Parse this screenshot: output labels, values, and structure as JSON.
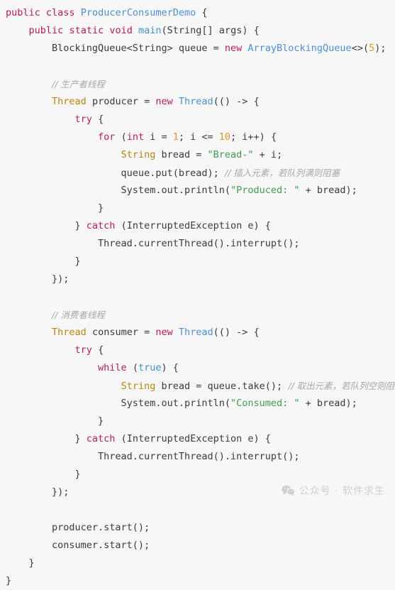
{
  "editor": {
    "language": "java",
    "background_color": "#f7f7f7",
    "default_text_color": "#3b3b3b",
    "colors": {
      "keyword": "#c2185b",
      "type": "#4a90d9",
      "declared_type": "#b8860b",
      "string": "#3f9c51",
      "number": "#d99a2b",
      "literal": "#2f95c9",
      "comment": "#a8a8a8"
    }
  },
  "code": {
    "lines": [
      [
        {
          "t": "public",
          "c": "kw"
        },
        {
          "t": " ",
          "c": "plain"
        },
        {
          "t": "class",
          "c": "kw"
        },
        {
          "t": " ",
          "c": "plain"
        },
        {
          "t": "ProducerConsumerDemo",
          "c": "type"
        },
        {
          "t": " {",
          "c": "plain"
        }
      ],
      [
        {
          "t": "    ",
          "c": "plain"
        },
        {
          "t": "public",
          "c": "kw"
        },
        {
          "t": " ",
          "c": "plain"
        },
        {
          "t": "static",
          "c": "kw"
        },
        {
          "t": " ",
          "c": "plain"
        },
        {
          "t": "void",
          "c": "kw"
        },
        {
          "t": " ",
          "c": "plain"
        },
        {
          "t": "main",
          "c": "type"
        },
        {
          "t": "(String[] args) {",
          "c": "plain"
        }
      ],
      [
        {
          "t": "        BlockingQueue<String> queue = ",
          "c": "plain"
        },
        {
          "t": "new",
          "c": "kw"
        },
        {
          "t": " ",
          "c": "plain"
        },
        {
          "t": "ArrayBlockingQueue",
          "c": "type"
        },
        {
          "t": "<>(",
          "c": "plain"
        },
        {
          "t": "5",
          "c": "num"
        },
        {
          "t": ");",
          "c": "plain"
        }
      ],
      [],
      [
        {
          "t": "        ",
          "c": "plain"
        },
        {
          "t": "// 生产者线程",
          "c": "cmt"
        }
      ],
      [
        {
          "t": "        ",
          "c": "plain"
        },
        {
          "t": "Thread",
          "c": "decl"
        },
        {
          "t": " producer = ",
          "c": "plain"
        },
        {
          "t": "new",
          "c": "kw"
        },
        {
          "t": " ",
          "c": "plain"
        },
        {
          "t": "Thread",
          "c": "type"
        },
        {
          "t": "(() -> {",
          "c": "plain"
        }
      ],
      [
        {
          "t": "            ",
          "c": "plain"
        },
        {
          "t": "try",
          "c": "kw"
        },
        {
          "t": " {",
          "c": "plain"
        }
      ],
      [
        {
          "t": "                ",
          "c": "plain"
        },
        {
          "t": "for",
          "c": "kw"
        },
        {
          "t": " (",
          "c": "plain"
        },
        {
          "t": "int",
          "c": "kw"
        },
        {
          "t": " i = ",
          "c": "plain"
        },
        {
          "t": "1",
          "c": "num"
        },
        {
          "t": "; i <= ",
          "c": "plain"
        },
        {
          "t": "10",
          "c": "num"
        },
        {
          "t": "; i++) {",
          "c": "plain"
        }
      ],
      [
        {
          "t": "                    ",
          "c": "plain"
        },
        {
          "t": "String",
          "c": "decl"
        },
        {
          "t": " bread = ",
          "c": "plain"
        },
        {
          "t": "\"Bread-\"",
          "c": "str"
        },
        {
          "t": " + i;",
          "c": "plain"
        }
      ],
      [
        {
          "t": "                    queue.put(bread); ",
          "c": "plain"
        },
        {
          "t": "// 插入元素，若队列满则阻塞",
          "c": "cmt"
        }
      ],
      [
        {
          "t": "                    System.out.println(",
          "c": "plain"
        },
        {
          "t": "\"Produced: \"",
          "c": "str"
        },
        {
          "t": " + bread);",
          "c": "plain"
        }
      ],
      [
        {
          "t": "                }",
          "c": "plain"
        }
      ],
      [
        {
          "t": "            } ",
          "c": "plain"
        },
        {
          "t": "catch",
          "c": "kw"
        },
        {
          "t": " (InterruptedException e) {",
          "c": "plain"
        }
      ],
      [
        {
          "t": "                Thread.currentThread().interrupt();",
          "c": "plain"
        }
      ],
      [
        {
          "t": "            }",
          "c": "plain"
        }
      ],
      [
        {
          "t": "        });",
          "c": "plain"
        }
      ],
      [],
      [
        {
          "t": "        ",
          "c": "plain"
        },
        {
          "t": "// 消费者线程",
          "c": "cmt"
        }
      ],
      [
        {
          "t": "        ",
          "c": "plain"
        },
        {
          "t": "Thread",
          "c": "decl"
        },
        {
          "t": " consumer = ",
          "c": "plain"
        },
        {
          "t": "new",
          "c": "kw"
        },
        {
          "t": " ",
          "c": "plain"
        },
        {
          "t": "Thread",
          "c": "type"
        },
        {
          "t": "(() -> {",
          "c": "plain"
        }
      ],
      [
        {
          "t": "            ",
          "c": "plain"
        },
        {
          "t": "try",
          "c": "kw"
        },
        {
          "t": " {",
          "c": "plain"
        }
      ],
      [
        {
          "t": "                ",
          "c": "plain"
        },
        {
          "t": "while",
          "c": "kw"
        },
        {
          "t": " (",
          "c": "plain"
        },
        {
          "t": "true",
          "c": "lit"
        },
        {
          "t": ") {",
          "c": "plain"
        }
      ],
      [
        {
          "t": "                    ",
          "c": "plain"
        },
        {
          "t": "String",
          "c": "decl"
        },
        {
          "t": " bread = queue.take(); ",
          "c": "plain"
        },
        {
          "t": "// 取出元素，若队列空则阻塞",
          "c": "cmt"
        }
      ],
      [
        {
          "t": "                    System.out.println(",
          "c": "plain"
        },
        {
          "t": "\"Consumed: \"",
          "c": "str"
        },
        {
          "t": " + bread);",
          "c": "plain"
        }
      ],
      [
        {
          "t": "                }",
          "c": "plain"
        }
      ],
      [
        {
          "t": "            } ",
          "c": "plain"
        },
        {
          "t": "catch",
          "c": "kw"
        },
        {
          "t": " (InterruptedException e) {",
          "c": "plain"
        }
      ],
      [
        {
          "t": "                Thread.currentThread().interrupt();",
          "c": "plain"
        }
      ],
      [
        {
          "t": "            }",
          "c": "plain"
        }
      ],
      [
        {
          "t": "        });",
          "c": "plain"
        }
      ],
      [],
      [
        {
          "t": "        producer.start();",
          "c": "plain"
        }
      ],
      [
        {
          "t": "        consumer.start();",
          "c": "plain"
        }
      ],
      [
        {
          "t": "    }",
          "c": "plain"
        }
      ],
      [
        {
          "t": "}",
          "c": "plain"
        }
      ]
    ]
  },
  "watermark": {
    "icon": "wechat-bubbles-icon",
    "text": "公众号 · 软件求生",
    "color": "#cfcfcf"
  }
}
